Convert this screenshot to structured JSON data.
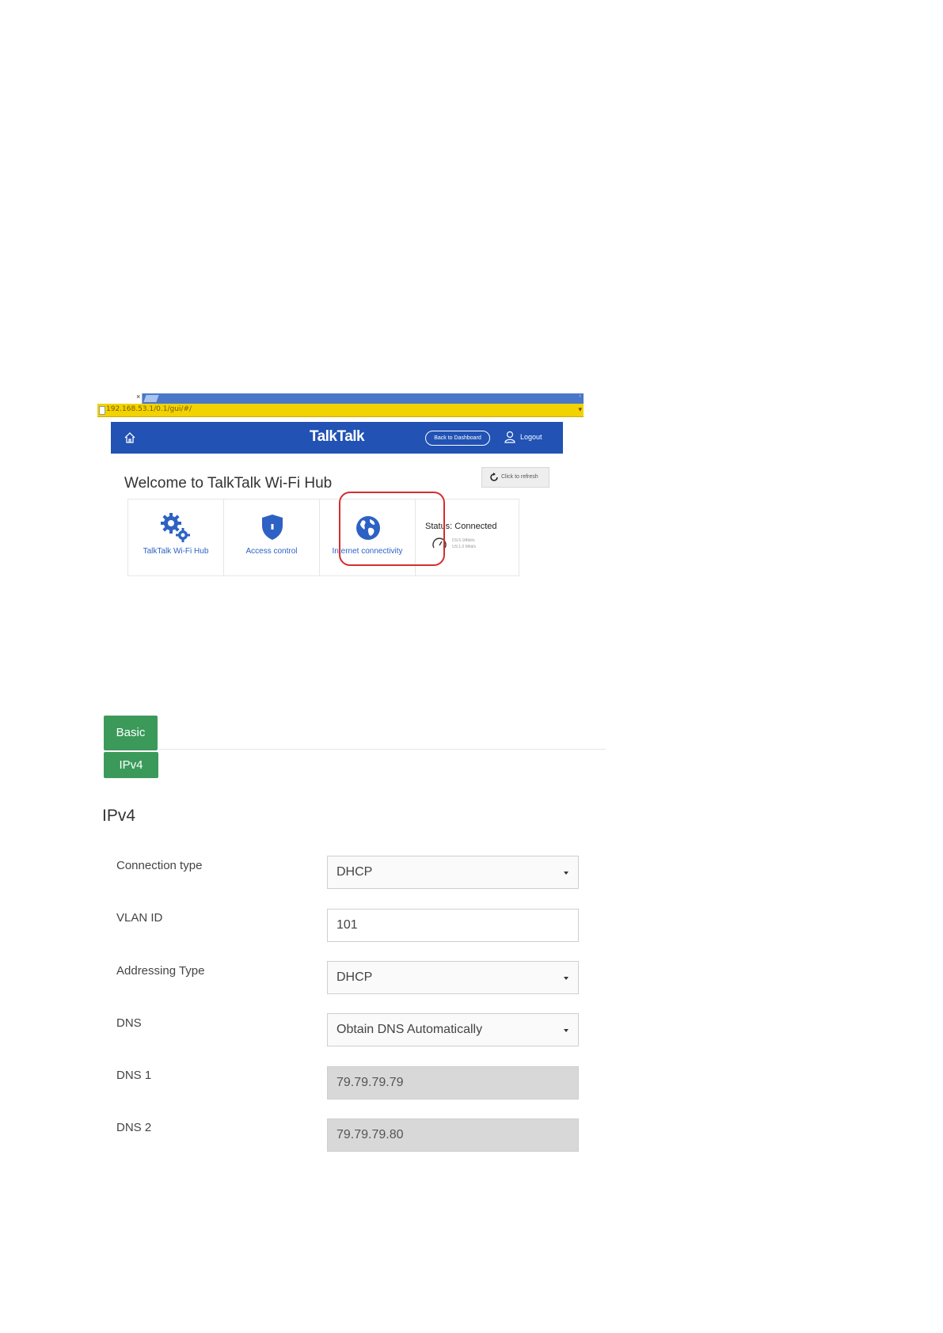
{
  "browser": {
    "tab_close": "×",
    "tab_menu": "ⁱ",
    "url": "192.168.53.1/0.1/gui/#/"
  },
  "dashboard": {
    "logo": "TalkTalk",
    "back_button": "Back to Dashboard",
    "logout": "Logout",
    "refresh": "Click to refresh",
    "welcome": "Welcome to  TalkTalk Wi-Fi Hub",
    "tiles": [
      {
        "label": "TalkTalk Wi-Fi Hub",
        "icon": "gears-icon"
      },
      {
        "label": "Access control",
        "icon": "shield-icon"
      },
      {
        "label": "Internet connectivity",
        "icon": "globe-icon"
      }
    ],
    "status": {
      "text": "Status:  Connected",
      "ds": "DS:5.1Mbit/s",
      "us": "US:1.0 Mbit/s"
    },
    "colors": {
      "brand_blue": "#2152b4",
      "highlight_red": "#d42d2d",
      "address_yellow": "#f2d200"
    }
  },
  "settings": {
    "tabs": {
      "basic": "Basic",
      "ipv4": "IPv4"
    },
    "title": "IPv4",
    "fields": [
      {
        "label": "Connection type",
        "value": "DHCP",
        "kind": "select"
      },
      {
        "label": "VLAN ID",
        "value": "101",
        "kind": "input"
      },
      {
        "label": "Addressing Type",
        "value": "DHCP",
        "kind": "select"
      },
      {
        "label": "DNS",
        "value": "Obtain DNS Automatically",
        "kind": "select"
      },
      {
        "label": "DNS 1",
        "value": "79.79.79.79",
        "kind": "disabled"
      },
      {
        "label": "DNS 2",
        "value": "79.79.79.80",
        "kind": "disabled"
      }
    ],
    "colors": {
      "tab_green": "#3b9a5a"
    }
  }
}
